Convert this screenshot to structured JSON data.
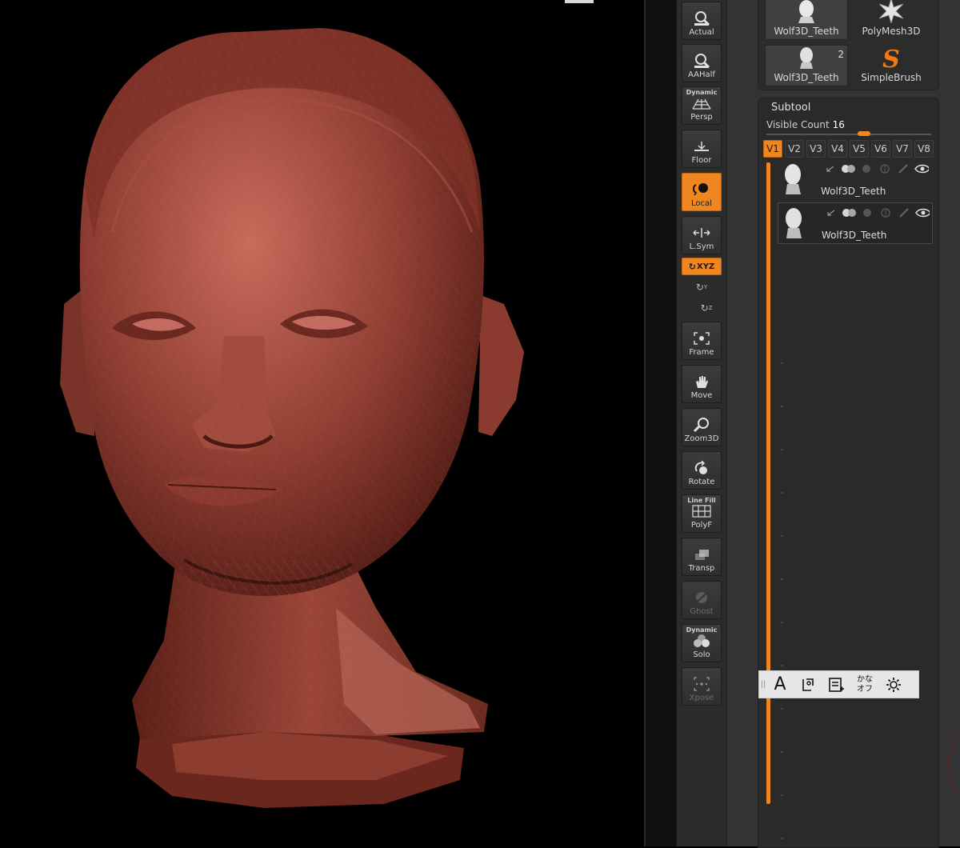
{
  "viewport": {
    "background": "#000000",
    "model": "3D head mesh rendered in reddish clay with polyframe wireframe"
  },
  "shelf": {
    "buttons": [
      {
        "label": "Actual",
        "icon": "actual-zoom-icon",
        "state": "normal"
      },
      {
        "label": "AAHalf",
        "icon": "aahalf-zoom-icon",
        "state": "normal"
      },
      {
        "label": "Persp",
        "top_label": "Dynamic",
        "icon": "perspective-grid-icon",
        "state": "normal"
      },
      {
        "label": "Floor",
        "icon": "floor-icon",
        "state": "normal"
      },
      {
        "label": "Local",
        "icon": "local-symmetry-icon",
        "state": "active"
      },
      {
        "label": "L.Sym",
        "icon": "lsym-icon",
        "state": "normal"
      },
      {
        "label": "Frame",
        "icon": "frame-icon",
        "state": "normal"
      },
      {
        "label": "Move",
        "icon": "move-hand-icon",
        "state": "normal"
      },
      {
        "label": "Zoom3D",
        "icon": "zoom3d-icon",
        "state": "normal"
      },
      {
        "label": "Rotate",
        "icon": "rotate-icon",
        "state": "normal"
      },
      {
        "label": "PolyF",
        "top_label": "Line Fill",
        "icon": "polyframe-icon",
        "state": "normal"
      },
      {
        "label": "Transp",
        "icon": "transparency-icon",
        "state": "normal"
      },
      {
        "label": "Ghost",
        "icon": "ghost-icon",
        "state": "disabled"
      },
      {
        "label": "Solo",
        "top_label": "Dynamic",
        "icon": "solo-icon",
        "state": "normal"
      },
      {
        "label": "Xpose",
        "icon": "xpose-icon",
        "state": "disabled"
      }
    ],
    "xyz_label": "XYZ",
    "axis_y": "Y",
    "axis_z": "Z",
    "accent": "#f0861f"
  },
  "tool_thumbs": [
    {
      "label": "Wolf3D_Teeth",
      "icon": "head-thumb-icon",
      "count": ""
    },
    {
      "label": "PolyMesh3D",
      "icon": "polymesh-star-icon",
      "count": ""
    },
    {
      "label": "Wolf3D_Teeth",
      "icon": "head-thumb-icon",
      "count": "2"
    },
    {
      "label": "SimpleBrush",
      "icon": "simplebrush-s-icon",
      "count": ""
    }
  ],
  "subtool": {
    "title": "Subtool",
    "visible_count_label": "Visible Count",
    "visible_count_value": "16",
    "tabs": [
      "V1",
      "V2",
      "V3",
      "V4",
      "V5",
      "V6",
      "V7",
      "V8"
    ],
    "active_tab": "V1",
    "items": [
      {
        "name": "Wolf3D_Teeth",
        "selected": false
      },
      {
        "name": "Wolf3D_Teeth",
        "selected": true
      }
    ]
  },
  "ime_toolbar": {
    "mode_label": "A",
    "kana_line1": "かな",
    "kana_line2": "オフ",
    "icons": [
      "ime-pad-icon",
      "ime-dictionary-icon",
      "ime-settings-gear-icon"
    ]
  }
}
